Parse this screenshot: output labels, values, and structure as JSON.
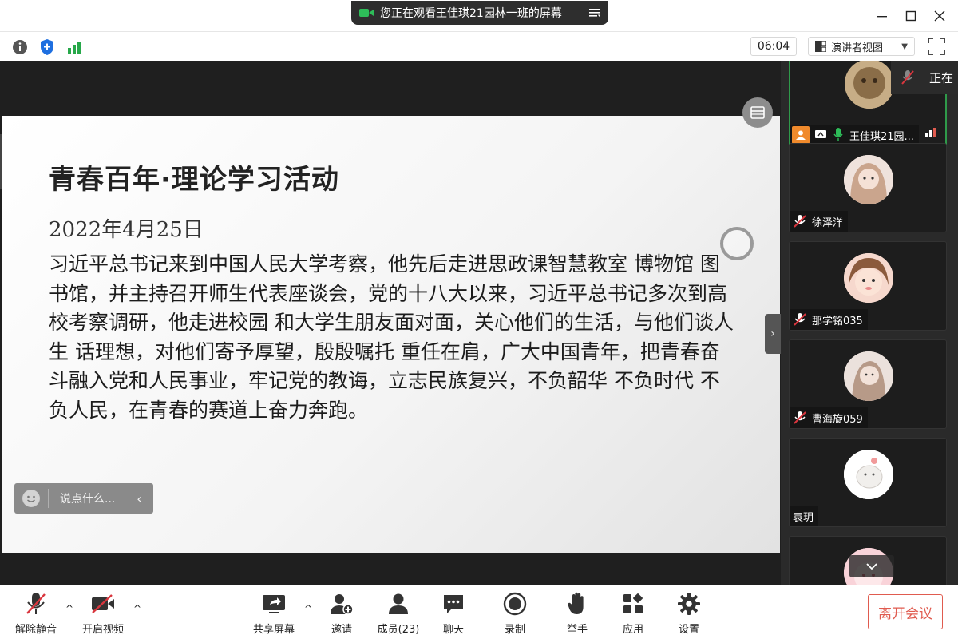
{
  "titlebar": {
    "share_notice": "您正在观看王佳琪21园林一班的屏幕",
    "menu_icon": "hamburger-icon",
    "window_controls": [
      "minimize-icon",
      "maximize-icon",
      "close-icon"
    ]
  },
  "subbar": {
    "icons": [
      "info-icon",
      "shield-icon",
      "signal-icon"
    ],
    "timer": "06:04",
    "view_mode": "演讲者视图",
    "fullscreen_icon": "fullscreen-icon"
  },
  "slide": {
    "title": "青春百年·理论学习活动",
    "date": "2022年4月25日",
    "body": "习近平总书记来到中国人民大学考察，他先后走进思政课智慧教室 博物馆  图书馆，并主持召开师生代表座谈会，党的十八大以来，习近平总书记多次到高校考察调研，他走进校园  和大学生朋友面对面，关心他们的生活，与他们谈人生  话理想，对他们寄予厚望，殷殷嘱托  重任在肩，广大中国青年，把青春奋斗融入党和人民事业，牢记党的教诲，立志民族复兴，不负韶华  不负时代  不负人民，在青春的赛道上奋力奔跑。"
  },
  "chat": {
    "placeholder": "说点什么..."
  },
  "speaking": {
    "label": "正在"
  },
  "participants": [
    {
      "name": "王佳琪21园...",
      "active": true
    },
    {
      "name": "徐泽洋",
      "muted": true
    },
    {
      "name": "那学铭035",
      "muted": true
    },
    {
      "name": "曹海旋059",
      "muted": true
    },
    {
      "name": "袁玥",
      "muted": false
    }
  ],
  "toolbar": {
    "unmute": "解除静音",
    "start_video": "开启视频",
    "share_screen": "共享屏幕",
    "invite": "邀请",
    "members": "成员(23)",
    "chat": "聊天",
    "record": "录制",
    "raise_hand": "举手",
    "apps": "应用",
    "settings": "设置",
    "leave": "离开会议"
  },
  "colors": {
    "accent_green": "#2f9a4a",
    "leave_red": "#e05b4f",
    "mute_red": "#d9363e"
  }
}
